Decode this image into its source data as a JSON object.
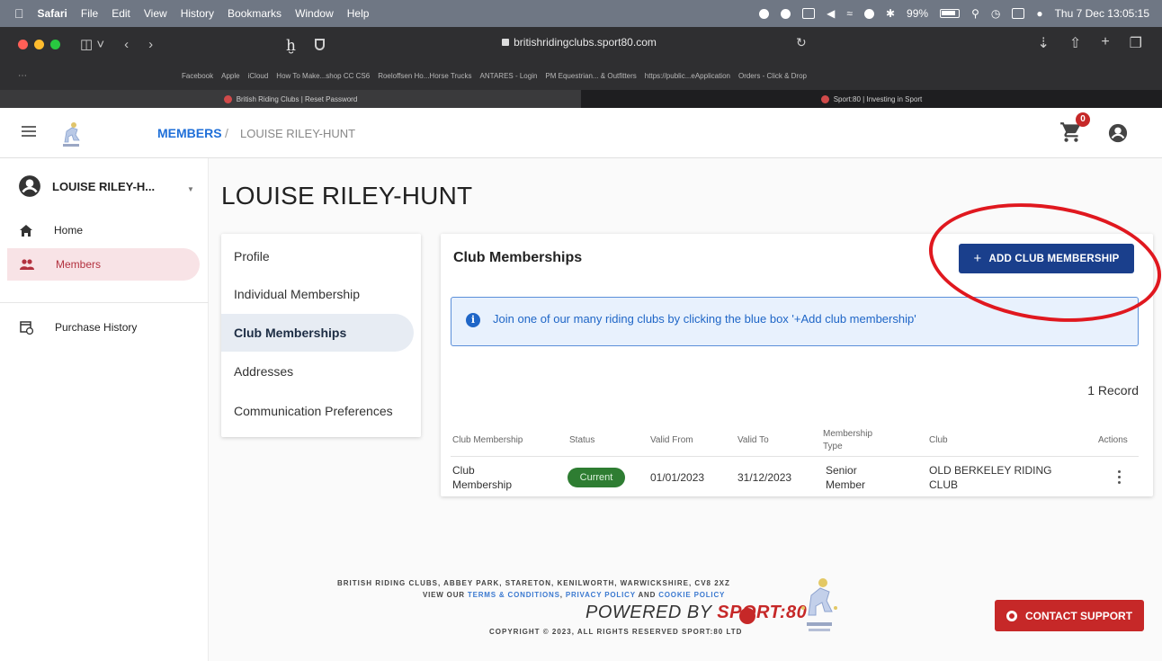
{
  "menubar": {
    "app": "Safari",
    "items": [
      "File",
      "Edit",
      "View",
      "History",
      "Bookmarks",
      "Window",
      "Help"
    ],
    "battery": "99%",
    "clock": "Thu 7 Dec  13:05:15"
  },
  "browser": {
    "url": "britishridingclubs.sport80.com",
    "bookmarks": [
      "Facebook",
      "Apple",
      "iCloud",
      "How To Make...shop CC CS6",
      "Roeloffsen Ho...Horse Trucks",
      "ANTARES - Login",
      "PM Equestrian... & Outfitters",
      "https://public...eApplication",
      "Orders - Click & Drop"
    ],
    "tabs": [
      {
        "label": "British Riding Clubs | Reset Password",
        "active": true
      },
      {
        "label": "Sport:80 | Investing in Sport",
        "active": false
      }
    ]
  },
  "appbar": {
    "breadcrumb_root": "MEMBERS",
    "breadcrumb_sep": "/",
    "breadcrumb_current": "LOUISE RILEY-HUNT",
    "cart_count": "0"
  },
  "sidebar": {
    "user_name": "LOUISE RILEY-H...",
    "items": [
      {
        "label": "Home",
        "icon": "home-icon",
        "active": false
      },
      {
        "label": "Members",
        "icon": "people-icon",
        "active": true
      },
      {
        "label": "Purchase History",
        "icon": "receipt-clock-icon",
        "active": false
      }
    ]
  },
  "main": {
    "title": "LOUISE RILEY-HUNT",
    "subnav": [
      {
        "label": "Profile",
        "active": false
      },
      {
        "label": "Individual Membership",
        "active": false
      },
      {
        "label": "Club Memberships",
        "active": true
      },
      {
        "label": "Addresses",
        "active": false
      },
      {
        "label": "Communication Preferences",
        "active": false
      }
    ],
    "card": {
      "title": "Club Memberships",
      "add_button": "ADD CLUB MEMBERSHIP",
      "info_text": "Join one of our many riding clubs by clicking the blue box '+Add club membership'",
      "record_count": "1 Record",
      "columns": [
        "Club Membership",
        "Status",
        "Valid From",
        "Valid To",
        "Membership Type",
        "Club",
        "Actions"
      ],
      "rows": [
        {
          "club_membership": "Club Membership",
          "status": "Current",
          "valid_from": "01/01/2023",
          "valid_to": "31/12/2023",
          "membership_type": "Senior Member",
          "club": "OLD BERKELEY RIDING CLUB"
        }
      ]
    }
  },
  "footer": {
    "address": "BRITISH RIDING CLUBS, ABBEY PARK, STARETON, KENILWORTH, WARWICKSHIRE, CV8 2XZ",
    "view_our": "VIEW OUR",
    "terms": "TERMS & CONDITIONS",
    "comma": ",",
    "privacy": "PRIVACY POLICY",
    "and": "AND",
    "cookie": "COOKIE POLICY",
    "powered_prefix": "POWERED BY",
    "powered_brand": "SPORT:80",
    "copyright": "COPYRIGHT © 2023, ALL RIGHTS RESERVED SPORT:80 LTD",
    "contact_button": "CONTACT SUPPORT"
  },
  "colors": {
    "primary": "#1a3f8c",
    "accent_red": "#c62828",
    "status_green": "#2e7d32",
    "info_blue": "#1f66c7",
    "annotation_red": "#e0181f"
  }
}
